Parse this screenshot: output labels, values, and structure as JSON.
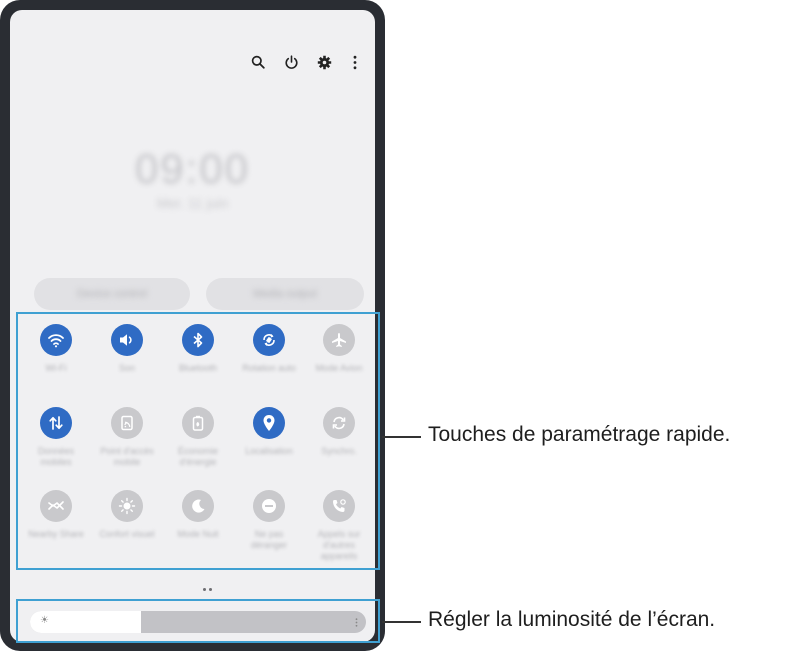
{
  "status": {
    "time": "09:00",
    "date": "Mer. 11 juin"
  },
  "top_icons": [
    "search-icon",
    "power-icon",
    "settings-icon",
    "more-options-icon"
  ],
  "pills": {
    "left": "Device control",
    "right": "Media output"
  },
  "quick_settings": [
    {
      "icon": "wifi-icon",
      "label": "Wi-Fi",
      "state": "on"
    },
    {
      "icon": "sound-icon",
      "label": "Son",
      "state": "on"
    },
    {
      "icon": "bluetooth-icon",
      "label": "Bluetooth",
      "state": "on"
    },
    {
      "icon": "auto-rotate-icon",
      "label": "Rotation auto",
      "state": "on"
    },
    {
      "icon": "airplane-icon",
      "label": "Mode Avion",
      "state": "off"
    },
    {
      "icon": "mobile-data-icon",
      "label": "Données mobiles",
      "state": "on"
    },
    {
      "icon": "hotspot-icon",
      "label": "Point d'accès mobile",
      "state": "off"
    },
    {
      "icon": "power-saving-icon",
      "label": "Économie d'énergie",
      "state": "off"
    },
    {
      "icon": "location-icon",
      "label": "Localisation",
      "state": "on"
    },
    {
      "icon": "sync-icon",
      "label": "Synchro.",
      "state": "off"
    },
    {
      "icon": "nearby-share-icon",
      "label": "Nearby Share",
      "state": "off"
    },
    {
      "icon": "eye-comfort-icon",
      "label": "Confort visuel",
      "state": "off"
    },
    {
      "icon": "dark-mode-icon",
      "label": "Mode Nuit",
      "state": "off"
    },
    {
      "icon": "do-not-disturb-icon",
      "label": "Ne pas déranger",
      "state": "off"
    },
    {
      "icon": "call-continuity-icon",
      "label": "Appels sur d'autres appareils",
      "state": "off"
    }
  ],
  "brightness": {
    "level": 0.33,
    "sun_glyph": "☀"
  },
  "callouts": {
    "quick_settings": "Touches de paramétrage rapide.",
    "brightness": "Régler la luminosité de l’écran."
  },
  "colors": {
    "active": "#2f6bc4",
    "inactive": "#c9c9cc",
    "highlight": "#3fa0d2"
  }
}
